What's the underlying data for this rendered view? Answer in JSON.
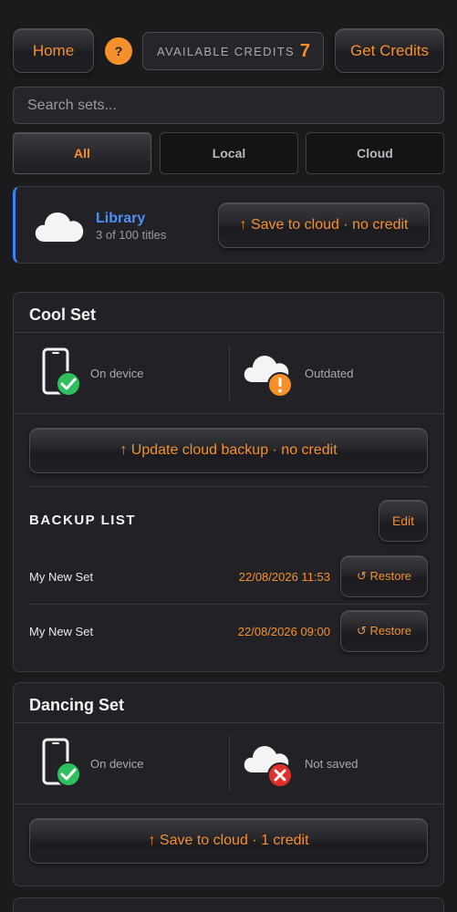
{
  "header": {
    "home_label": "Home",
    "help_label": "?",
    "credits_label": "AVAILABLE CREDITS",
    "credits_value": "7",
    "get_credits_label": "Get Credits"
  },
  "search": {
    "placeholder": "Search sets..."
  },
  "filters": [
    {
      "label": "All",
      "active": true
    },
    {
      "label": "Local",
      "active": false
    },
    {
      "label": "Cloud",
      "active": false
    }
  ],
  "library": {
    "title": "Library",
    "subtitle": "3 of 100 titles",
    "save_label": "↑ Save to cloud · no credit"
  },
  "sets": [
    {
      "title": "Cool Set",
      "device_status": "On device",
      "cloud_status": "Outdated",
      "action_label": "↑ Update cloud backup · no credit",
      "backup_list_label": "BACKUP LIST",
      "edit_label": "Edit",
      "backups": [
        {
          "name": "My New Set",
          "date": "22/08/2026 11:53",
          "restore_label": "↺ Restore"
        },
        {
          "name": "My New Set",
          "date": "22/08/2026 09:00",
          "restore_label": "↺ Restore"
        }
      ]
    },
    {
      "title": "Dancing Set",
      "device_status": "On device",
      "cloud_status": "Not saved",
      "action_label": "↑ Save to cloud · 1 credit"
    }
  ],
  "colors": {
    "accent": "#f5902a",
    "library_blue": "#4f8ff7",
    "ok_green": "#2fbf5f",
    "warn_orange": "#f5902a",
    "error_red": "#e0302b"
  }
}
